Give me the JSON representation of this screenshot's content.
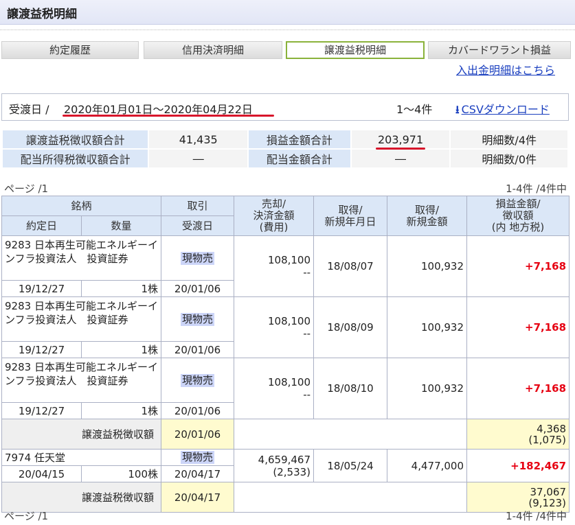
{
  "page": {
    "title": "譲渡益税明細"
  },
  "tabs": [
    {
      "label": "約定履歴",
      "active": false
    },
    {
      "label": "信用決済明細",
      "active": false
    },
    {
      "label": "譲渡益税明細",
      "active": true
    },
    {
      "label": "カバードワラント損益",
      "active": false
    }
  ],
  "deposit_link": "入出金明細はこちら",
  "date_filter": {
    "label": "受渡日 /",
    "range": "2020年01月01日〜2020年04月22日",
    "count": "1〜4件",
    "csv_label": "CSVダウンロード",
    "csv_icon": "download-arrow-icon"
  },
  "summary": {
    "row1": {
      "h1": "譲渡益税徴収額合計",
      "v1": "41,435",
      "h2": "損益金額合計",
      "v2": "203,971",
      "c": "明細数/4件"
    },
    "row2": {
      "h1": "配当所得税徴収額合計",
      "v1": "―",
      "h2": "配当金額合計",
      "v2": "―",
      "c": "明細数/0件"
    }
  },
  "pager": {
    "left": "ページ /1",
    "right": "1-4件 /4件中"
  },
  "headers": {
    "meigara": "銘柄",
    "torihiki": "取引",
    "baikyaku": "売却/\n決済金額\n(費用)",
    "shutoku_date": "取得/\n新規年月日",
    "shutoku_amt": "取得/\n新規金額",
    "soneki": "損益金額/\n徴収額\n(内 地方税)",
    "yakujo": "約定日",
    "suryo": "数量",
    "ukewatashi": "受渡日"
  },
  "rows": [
    {
      "name": "9283 日本再生可能エネルギーインフラ投資法人　投資証券",
      "trade": "現物売",
      "sale": "108,100",
      "fee": "--",
      "acq_date": "18/08/07",
      "acq_amt": "100,932",
      "pl": "+7,168",
      "exec": "19/12/27",
      "qty": "1株",
      "settle": "20/01/06"
    },
    {
      "name": "9283 日本再生可能エネルギーインフラ投資法人　投資証券",
      "trade": "現物売",
      "sale": "108,100",
      "fee": "--",
      "acq_date": "18/08/09",
      "acq_amt": "100,932",
      "pl": "+7,168",
      "exec": "19/12/27",
      "qty": "1株",
      "settle": "20/01/06"
    },
    {
      "name": "9283 日本再生可能エネルギーインフラ投資法人　投資証券",
      "trade": "現物売",
      "sale": "108,100",
      "fee": "--",
      "acq_date": "18/08/10",
      "acq_amt": "100,932",
      "pl": "+7,168",
      "exec": "19/12/27",
      "qty": "1株",
      "settle": "20/01/06"
    }
  ],
  "tax1": {
    "label": "譲渡益税徴収額",
    "date": "20/01/06",
    "amt": "4,368",
    "local": "(1,075)"
  },
  "row4": {
    "name": "7974 任天堂",
    "trade": "現物売",
    "sale": "4,659,467",
    "fee": "(2,533)",
    "acq_date": "18/05/24",
    "acq_amt": "4,477,000",
    "pl": "+182,467",
    "exec": "20/04/15",
    "qty": "100株",
    "settle": "20/04/17"
  },
  "tax2": {
    "label": "譲渡益税徴収額",
    "date": "20/04/17",
    "amt": "37,067",
    "local": "(9,123)"
  }
}
